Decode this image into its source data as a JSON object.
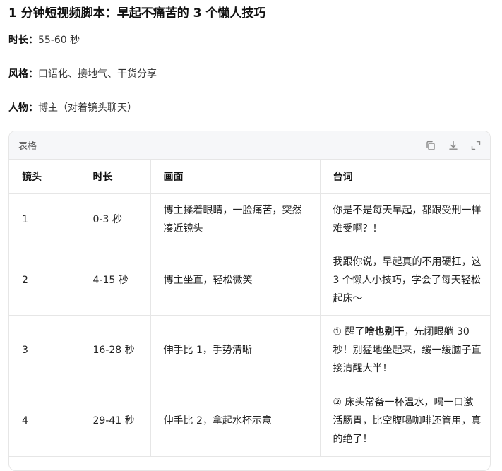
{
  "title": "1 分钟短视频脚本：早起不痛苦的 3 个懒人技巧",
  "meta": {
    "duration_label": "时长：",
    "duration_value": "55-60 秒",
    "style_label": "风格：",
    "style_value": "口语化、接地气、干货分享",
    "character_label": "人物：",
    "character_value": "博主（对着镜头聊天）"
  },
  "table_card": {
    "label": "表格",
    "actions": {
      "copy_icon": "copy-icon",
      "download_icon": "download-icon",
      "expand_icon": "expand-icon"
    },
    "headers": [
      "镜头",
      "时长",
      "画面",
      "台词"
    ],
    "rows": [
      {
        "shot": "1",
        "time": "0-3 秒",
        "scene": "博主揉着眼睛，一脸痛苦，突然凑近镜头",
        "line": "你是不是每天早起，都跟受刑一样难受啊？！"
      },
      {
        "shot": "2",
        "time": "4-15 秒",
        "scene": "博主坐直，轻松微笑",
        "line": "我跟你说，早起真的不用硬扛，这 3 个懒人小技巧，学会了每天轻松起床～"
      },
      {
        "shot": "3",
        "time": "16-28 秒",
        "scene": "伸手比 1，手势清晰",
        "line_prefix": "① 醒了",
        "line_bold": "啥也别干",
        "line_suffix": "，先闭眼躺 30 秒！别猛地坐起来，缓一缓脑子直接清醒大半！"
      },
      {
        "shot": "4",
        "time": "29-41 秒",
        "scene": "伸手比 2，拿起水杯示意",
        "line": "② 床头常备一杯温水，喝一口激活肠胃，比空腹喝咖啡还管用，真的绝了！"
      }
    ]
  }
}
